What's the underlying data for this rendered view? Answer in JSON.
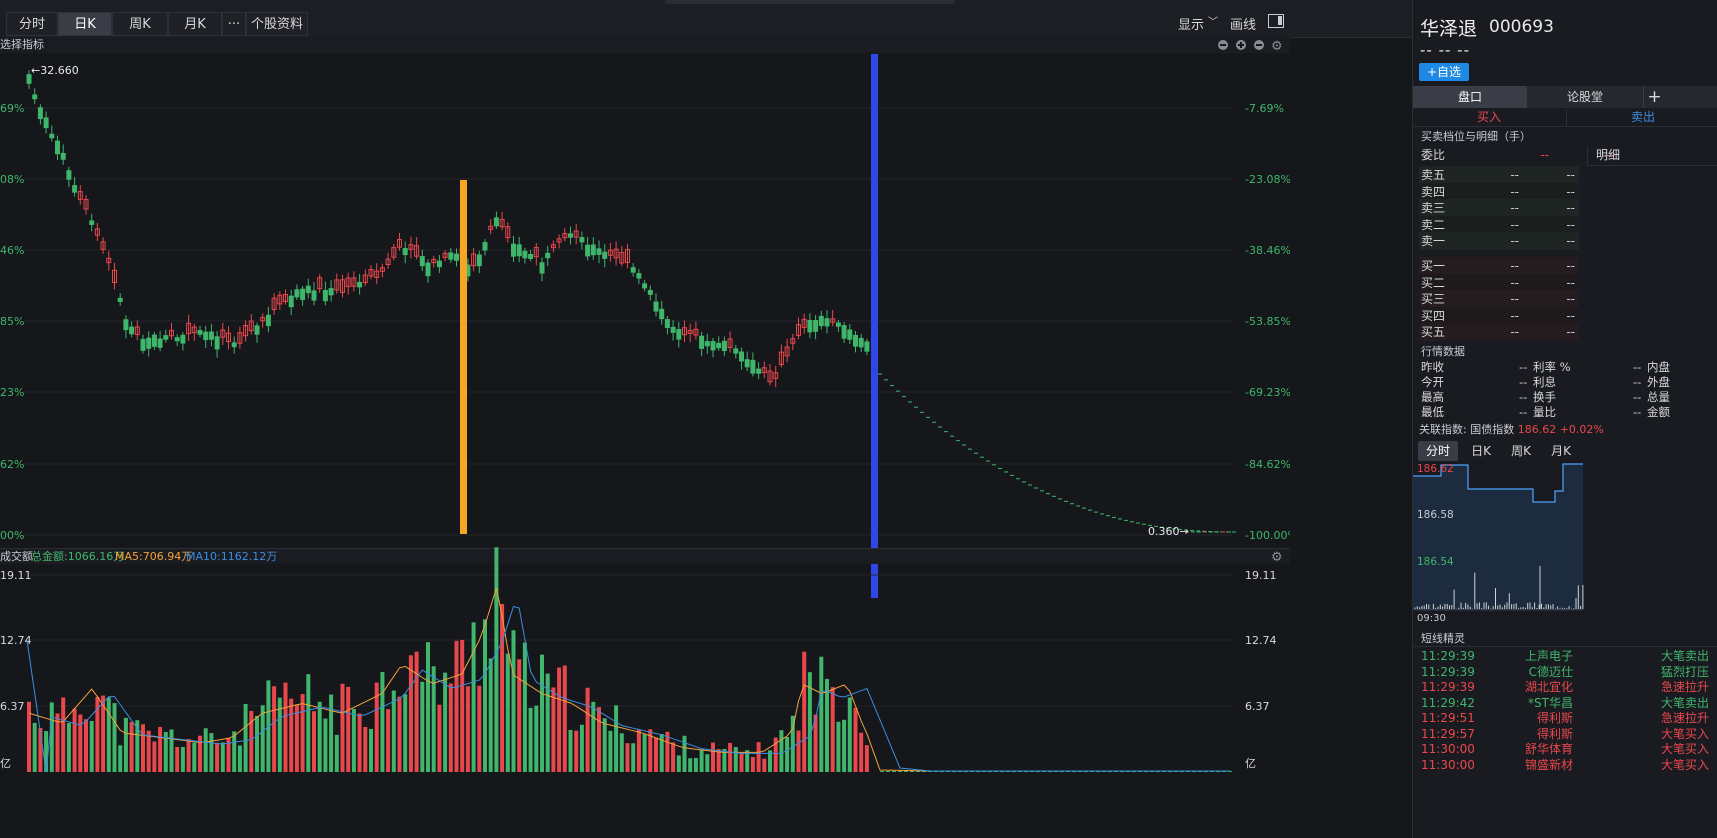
{
  "toolbar": {
    "tabs": [
      "分时",
      "日K",
      "周K",
      "月K",
      "···",
      "个股资料"
    ],
    "active_tab": "日K",
    "display_label": "显示",
    "draw_label": "画线"
  },
  "main_chart": {
    "indicator_label": "选择指标",
    "max_label": "←32.660",
    "min_label": "0.360→",
    "left_axis": [
      "69%",
      "08%",
      "46%",
      "85%",
      "23%",
      "62%",
      "00%"
    ],
    "right_axis": [
      "-7.69%",
      "-23.08%",
      "-38.46%",
      "-53.85%",
      "-69.23%",
      "-84.62%",
      "-100.00%"
    ],
    "colors": {
      "up": "#e8474c",
      "down": "#3fb66b",
      "orange_marker": "#f5a623",
      "blue_marker": "#2f47e8"
    }
  },
  "volume_chart": {
    "title": "成交额",
    "total_label": "总金额:1066.16万",
    "ma5_label": "MA5:706.94万",
    "ma10_label": "MA10:1162.12万",
    "left_axis": [
      "19.11",
      "12.74",
      "6.37",
      "亿"
    ],
    "right_axis": [
      "19.11",
      "12.74",
      "6.37",
      "亿"
    ],
    "colors": {
      "ma5": "#f2a23a",
      "ma10": "#3b8de0"
    }
  },
  "stock": {
    "name": "华泽退",
    "code": "000693",
    "price_placeholder": "-- -- --",
    "add_watch": "+自选"
  },
  "panel_tabs": [
    "盘口",
    "论股堂"
  ],
  "buy_label": "买入",
  "sell_label": "卖出",
  "orderbook_title": "买卖档位与明细（手）",
  "weibi_label": "委比",
  "weibi_v1": "--",
  "weibi_v2": "--",
  "detail_label": "明细",
  "asks": [
    {
      "label": "卖五",
      "v1": "--",
      "v2": "--"
    },
    {
      "label": "卖四",
      "v1": "--",
      "v2": "--"
    },
    {
      "label": "卖三",
      "v1": "--",
      "v2": "--"
    },
    {
      "label": "卖二",
      "v1": "--",
      "v2": "--"
    },
    {
      "label": "卖一",
      "v1": "--",
      "v2": "--"
    }
  ],
  "bids": [
    {
      "label": "买一",
      "v1": "--",
      "v2": "--"
    },
    {
      "label": "买二",
      "v1": "--",
      "v2": "--"
    },
    {
      "label": "买三",
      "v1": "--",
      "v2": "--"
    },
    {
      "label": "买四",
      "v1": "--",
      "v2": "--"
    },
    {
      "label": "买五",
      "v1": "--",
      "v2": "--"
    }
  ],
  "market_data_title": "行情数据",
  "market_data": [
    {
      "a": "昨收",
      "av": "--",
      "b": "利率 %",
      "bv": "--",
      "c": "内盘"
    },
    {
      "a": "今开",
      "av": "--",
      "b": "利息",
      "bv": "--",
      "c": "外盘"
    },
    {
      "a": "最高",
      "av": "--",
      "b": "换手",
      "bv": "--",
      "c": "总量"
    },
    {
      "a": "最低",
      "av": "--",
      "b": "量比",
      "bv": "--",
      "c": "金额"
    }
  ],
  "related_index": {
    "label": "关联指数:",
    "name": "国债指数",
    "value": "186.62 +0.02%"
  },
  "mini_tabs": [
    "分时",
    "日K",
    "周K",
    "月K"
  ],
  "mini_chart": {
    "high": "186.62",
    "mid": "186.58",
    "low": "186.54",
    "time": "09:30"
  },
  "short_events_title": "短线精灵",
  "short_events": [
    {
      "time": "11:29:39",
      "name": "上声电子",
      "event": "大笔卖出",
      "color": "#3fb66b"
    },
    {
      "time": "11:29:39",
      "name": "C德迈仕",
      "event": "猛烈打压",
      "color": "#3fb66b"
    },
    {
      "time": "11:29:39",
      "name": "湖北宜化",
      "event": "急速拉升",
      "color": "#e8474c"
    },
    {
      "time": "11:29:42",
      "name": "*ST华昌",
      "event": "大笔卖出",
      "color": "#3fb66b"
    },
    {
      "time": "11:29:51",
      "name": "得利斯",
      "event": "急速拉升",
      "color": "#e8474c"
    },
    {
      "time": "11:29:57",
      "name": "得利斯",
      "event": "大笔买入",
      "color": "#e8474c"
    },
    {
      "time": "11:30:00",
      "name": "舒华体育",
      "event": "大笔买入",
      "color": "#e8474c"
    },
    {
      "time": "11:30:00",
      "name": "锦盛新材",
      "event": "大笔买入",
      "color": "#e8474c"
    }
  ]
}
